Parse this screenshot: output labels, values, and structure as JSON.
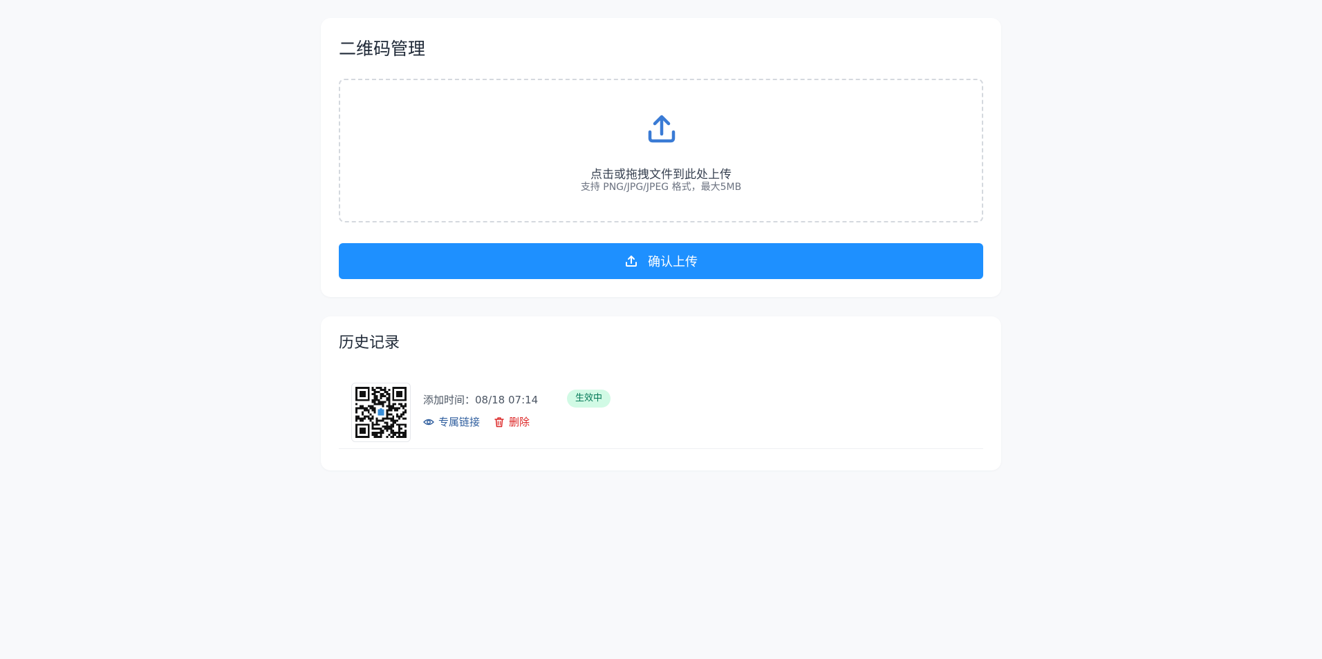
{
  "upload_card": {
    "title": "二维码管理",
    "dropzone": {
      "icon": "upload-icon",
      "title": "点击或拖拽文件到此处上传",
      "hint": "支持 PNG/JPG/JPEG 格式，最大5MB"
    },
    "confirm_button": {
      "icon": "upload-icon",
      "label": "确认上传"
    }
  },
  "history_card": {
    "title": "历史记录",
    "items": [
      {
        "thumbnail": "qr-code-image",
        "added_time": "添加时间：08/18 07:14",
        "status": "生效中",
        "actions": {
          "link_icon": "eye-icon",
          "link_label": "专属链接",
          "delete_icon": "trash-icon",
          "delete_label": "删除"
        }
      }
    ]
  },
  "colors": {
    "primary": "#1e90ff",
    "icon_blue": "#3a7bd5",
    "status_bg": "#d1fae5",
    "status_text": "#047857",
    "danger": "#dc2626",
    "link": "#2f5e9e",
    "page_bg": "#f8f9fb"
  }
}
